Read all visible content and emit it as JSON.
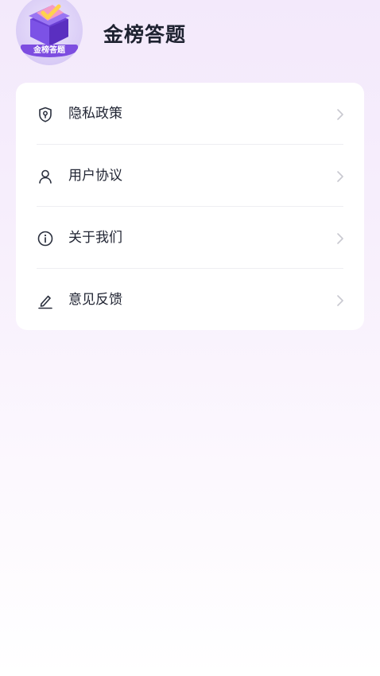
{
  "app": {
    "logo_badge_text": "金榜答题",
    "title": "金榜答题"
  },
  "menu": {
    "items": [
      {
        "label": "隐私政策",
        "icon": "shield-key-icon"
      },
      {
        "label": "用户协议",
        "icon": "user-icon"
      },
      {
        "label": "关于我们",
        "icon": "info-circle-icon"
      },
      {
        "label": "意见反馈",
        "icon": "pencil-icon"
      }
    ]
  },
  "colors": {
    "background_top": "#f3e9fb",
    "background_bottom": "#ffffff",
    "card": "#ffffff",
    "logo_accent": "#7d4de0",
    "text": "#222634",
    "chevron": "#c8c8d0"
  }
}
